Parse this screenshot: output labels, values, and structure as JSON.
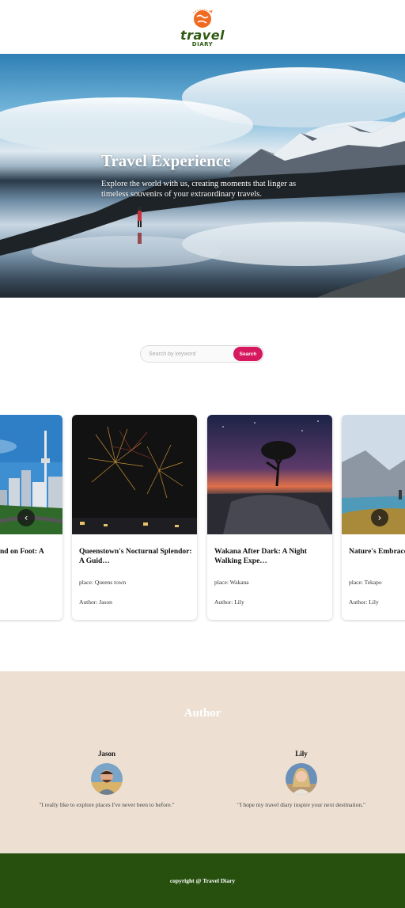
{
  "brand": {
    "name": "travel",
    "sub": "DIARY",
    "accent": "#f06a22",
    "green": "#2e5a12"
  },
  "hero": {
    "title": "Travel Experience",
    "subtitle": "Explore the world with us, creating moments that linger as timeless souvenirs of your extraordinary travels."
  },
  "search": {
    "placeholder": "Search by keyword",
    "button": "Search",
    "button_color": "#d6185e"
  },
  "cards": [
    {
      "title": "nd on Foot: A",
      "place": "",
      "author": "",
      "icon": "city-tower-photo"
    },
    {
      "title": "Queenstown's Nocturnal Splendor: A Guid…",
      "place": "place: Queens town",
      "author": "Author: Jason",
      "icon": "fireworks-photo"
    },
    {
      "title": "Wakana After Dark: A Night Walking Expe…",
      "place": "place: Wakana",
      "author": "Author: Lily",
      "icon": "night-tree-photo"
    },
    {
      "title": "Nature's Embrace Walkthroug…",
      "place": "place: Tekapo",
      "author": "Author: Lily",
      "icon": "mountain-lake-photo"
    }
  ],
  "carousel": {
    "prev_icon": "chevron-left-icon",
    "next_icon": "chevron-right-icon"
  },
  "authors": {
    "title": "Author",
    "list": [
      {
        "name": "Jason",
        "quote": "\"I really like to explore places I've never been to before.\""
      },
      {
        "name": "Lily",
        "quote": "\"I hope my travel diary inspire your next destination.\""
      }
    ],
    "background": "#ede0d3"
  },
  "footer": {
    "text": "copyright @ Travel Diary",
    "background": "#27500f"
  }
}
